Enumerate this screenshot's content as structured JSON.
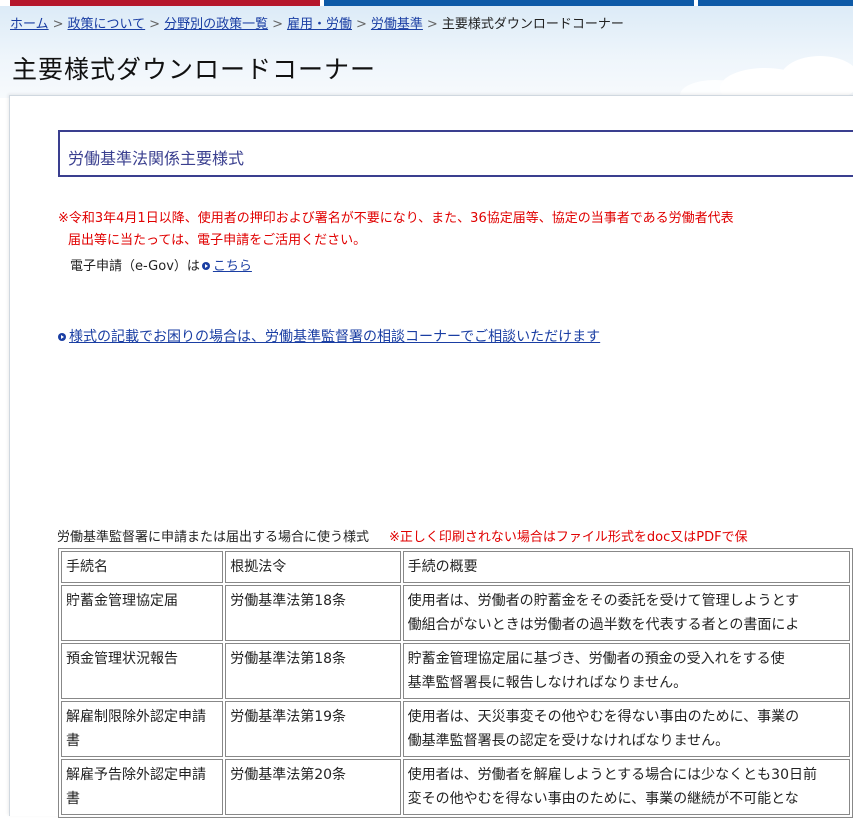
{
  "breadcrumb": {
    "items": [
      "ホーム",
      "政策について",
      "分野別の政策一覧",
      "雇用・労働",
      "労働基準"
    ],
    "current": "主要様式ダウンロードコーナー"
  },
  "page": {
    "title": "主要様式ダウンロードコーナー"
  },
  "section": {
    "heading": "労働基準法関係主要様式"
  },
  "notice": {
    "line1": "※令和3年4月1日以降、使用者の押印および署名が不要になり、また、36協定届等、協定の当事者である労働者代表",
    "line2": "届出等に当たっては、電子申請をご活用ください。"
  },
  "egov": {
    "label": "電子申請（e-Gov）は",
    "link": "こちら"
  },
  "consult": {
    "link": "様式の記載でお困りの場合は、労働基準監督署の相談コーナーでご相談いただけます"
  },
  "table": {
    "caption": "労働基準監督署に申請または届出する場合に使う様式",
    "warning": "※正しく印刷されない場合はファイル形式をdoc又はPDFで保",
    "headers": [
      "手続名",
      "根拠法令",
      "手続の概要"
    ],
    "rows": [
      {
        "name": "貯蓄金管理協定届",
        "law": "労働基準法第18条",
        "summary1": "使用者は、労働者の貯蓄金をその委託を受けて管理しようとす",
        "summary2": "働組合がないときは労働者の過半数を代表する者との書面によ"
      },
      {
        "name": "預金管理状況報告",
        "law": "労働基準法第18条",
        "summary1": "貯蓄金管理協定届に基づき、労働者の預金の受入れをする使",
        "summary2": "基準監督署長に報告しなければなりません。"
      },
      {
        "name": "解雇制限除外認定申請書",
        "law": "労働基準法第19条",
        "summary1": "使用者は、天災事変その他やむを得ない事由のために、事業の",
        "summary2": "働基準監督署長の認定を受けなければなりません。"
      },
      {
        "name": "解雇予告除外認定申請書",
        "law": "労働基準法第20条",
        "summary1": "使用者は、労働者を解雇しようとする場合には少なくとも30日前",
        "summary2": "変その他やむを得ない事由のために、事業の継続が不可能とな"
      }
    ]
  },
  "colors": {
    "link": "#1a3ea3",
    "notice": "#e00000",
    "heading_border": "#3a3f8f",
    "header_band": "#dcebf7"
  }
}
